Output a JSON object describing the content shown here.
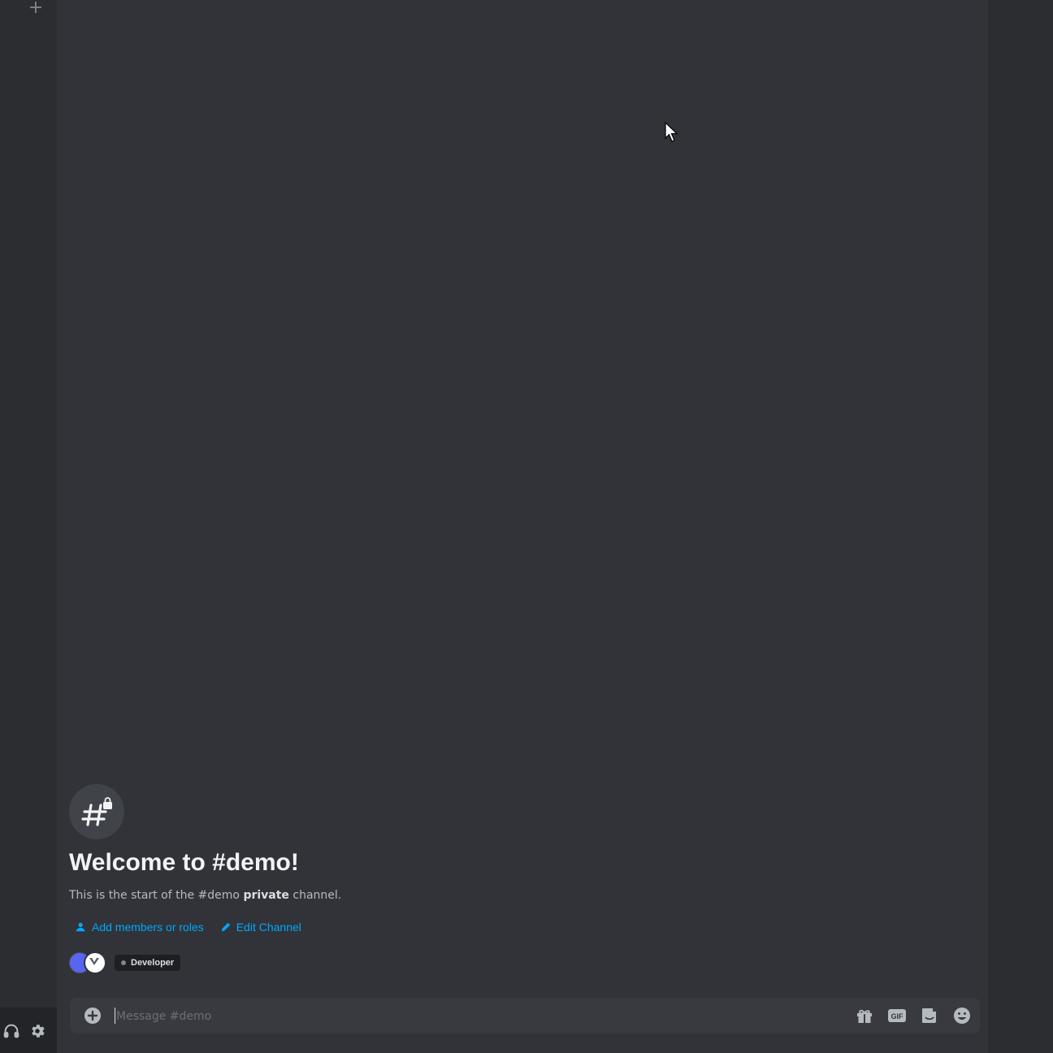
{
  "window": {
    "rail_add_icon": "plus-icon"
  },
  "channel": {
    "name": "#demo",
    "icon": "hash-lock-icon"
  },
  "welcome": {
    "title": "Welcome to #demo!",
    "desc_prefix": "This is the start of the #demo ",
    "desc_bold": "private",
    "desc_suffix": " channel."
  },
  "actions": {
    "add_members": "Add members or roles",
    "edit_channel": "Edit Channel"
  },
  "roles": {
    "pill": "Developer"
  },
  "composer": {
    "placeholder": "Message #demo",
    "icons": [
      "gift-icon",
      "gif-icon",
      "sticker-icon",
      "emoji-icon"
    ]
  },
  "colors": {
    "accent_link": "#00a8fc",
    "background": "#313338",
    "rail": "#2b2d31"
  }
}
